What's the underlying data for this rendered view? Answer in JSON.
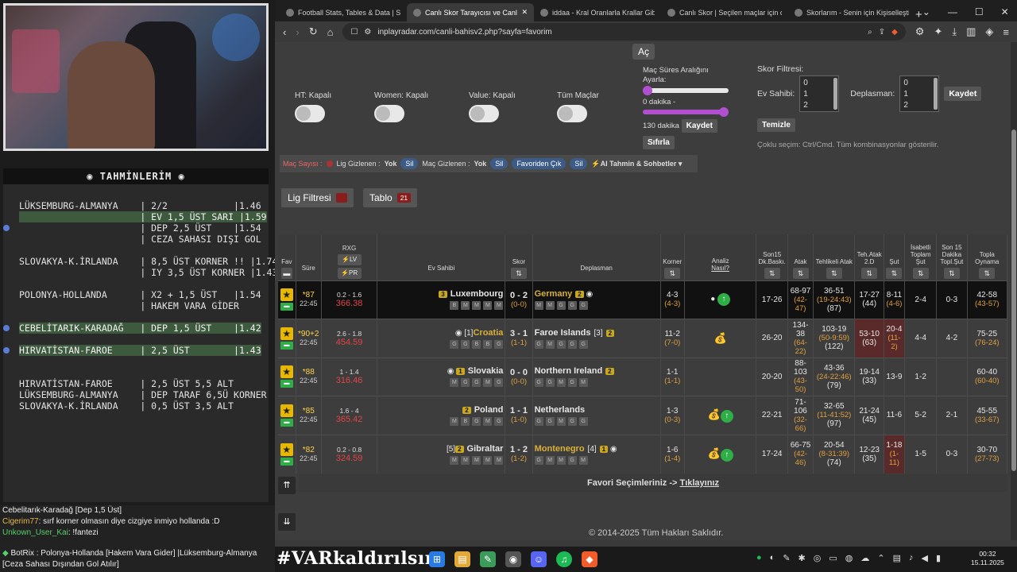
{
  "stream": {
    "predictions_title": "TAHMİNLERİM",
    "predictions": [
      {
        "text": "LÜKSEMBURG-ALMANYA    | 2/2            |1.46",
        "hl": false,
        "dot": false
      },
      {
        "text": "                      | EV 1,5 ÜST SARI |1.59",
        "hl": true,
        "dot": false
      },
      {
        "text": "                      | DEP 2,5 ÜST    |1.54",
        "hl": false,
        "dot": true
      },
      {
        "text": "                      | CEZA SAHASI DIŞI GOL",
        "hl": false,
        "dot": false
      },
      {
        "text": "",
        "hl": false,
        "dot": false
      },
      {
        "text": "SLOVAKYA-K.İRLANDA    | 8,5 ÜST KORNER !! |1.74",
        "hl": false,
        "dot": false
      },
      {
        "text": "                      | IY 3,5 ÜST KORNER |1.43",
        "hl": false,
        "dot": false
      },
      {
        "text": "",
        "hl": false,
        "dot": false
      },
      {
        "text": "POLONYA-HOLLANDA      | X2 + 1,5 ÜST   |1.54",
        "hl": false,
        "dot": false
      },
      {
        "text": "                      | HAKEM VARA GİDER",
        "hl": false,
        "dot": false
      },
      {
        "text": "",
        "hl": false,
        "dot": false
      },
      {
        "text": "CEBELİTARIK-KARADAĞ   | DEP 1,5 ÜST    |1.42",
        "hl": true,
        "dot": true
      },
      {
        "text": "",
        "hl": false,
        "dot": false
      },
      {
        "text": "HIRVATİSTAN-FAROE     | 2,5 ÜST        |1.43",
        "hl": true,
        "dot": true
      },
      {
        "text": "",
        "hl": false,
        "dot": false
      },
      {
        "text": "",
        "hl": false,
        "dot": false
      },
      {
        "text": "HIRVATİSTAN-FAROE     | 2,5 ÜST 5,5 ALT",
        "hl": false,
        "dot": false
      },
      {
        "text": "LÜKSEMBURG-ALMANYA    | DEP TARAF 6,5Ü KORNER",
        "hl": false,
        "dot": false
      },
      {
        "text": "SLOVAKYA-K.İRLANDA    | 0,5 ÜST 3,5 ALT",
        "hl": false,
        "dot": false
      }
    ],
    "chat": [
      {
        "user": "",
        "msg": "Cebelitarık-Karadağ [Dep 1,5 Üst]",
        "cls": ""
      },
      {
        "user": "Cigerim77",
        "msg": ": sırf korner olmasın diye cizgiye inmiyo hollanda :D",
        "cls": "u1"
      },
      {
        "user": "Unkown_User_Kai",
        "msg": ": !fantezi",
        "cls": "u3"
      }
    ],
    "bot_line1": "BotRix : Polonya-Hollanda [Hakem Vara Gider] |Lüksemburg-Almanya",
    "bot_line2": "[Ceza Sahası Dışından Gol Atılır]",
    "hashtag": "#VARkaldırılsın"
  },
  "browser": {
    "tabs": [
      {
        "label": "Football Stats, Tables & Data | Socc",
        "active": false
      },
      {
        "label": "Canlı Skor Tarayıcısı ve Canlı Sk",
        "active": true
      },
      {
        "label": "iddaa - Kral Oranlarla Krallar Gibi K",
        "active": false
      },
      {
        "label": "Canlı Skor | Seçilen maçlar için canl",
        "active": false
      },
      {
        "label": "Skorlarım - Senin için Kişiselleştirilm",
        "active": false
      }
    ],
    "url": "inplayradar.com/canli-bahisv2.php?sayfa=favorim"
  },
  "page": {
    "ac_label": "Aç",
    "toggles": [
      "HT: Kapalı",
      "Women: Kapalı",
      "Value: Kapalı",
      "Tüm Maçlar"
    ],
    "duration_label": "Maç Süres Aralığını Ayarla:",
    "duration_min": "0 dakika -",
    "duration_max": "130 dakika",
    "save_label": "Kaydet",
    "reset_label": "Sıfırla",
    "score_filter_label": "Skor Filtresi:",
    "home_label": "Ev Sahibi:",
    "away_label": "Deplasman:",
    "score_options": [
      "0",
      "1",
      "2"
    ],
    "clear_label": "Temizle",
    "hint": "Çoklu seçim: Ctrl/Cmd. Tüm kombinasyonlar gösterilir.",
    "match_count_label": "Maç Sayısı :",
    "league_hidden_label": "Lig Gizlenen :",
    "none_label": "Yok",
    "delete_label": "Sil",
    "match_hidden_label": "Maç Gizlenen :",
    "remove_fav_label": "Favoriden Çık",
    "ai_label": "AI Tahmin & Sohbetler",
    "league_filter_label": "Lig Filtresi",
    "table_label": "Tablo",
    "table_count": "21",
    "fav_selection_text": "Favori Seçimleriniz ->",
    "fav_link": "Tıklayınız",
    "copyright": "© 2014-2025 Tüm Hakları Saklıdır."
  },
  "table": {
    "headers": {
      "fav": "Fav",
      "sure": "Süre",
      "rxg": "RXG",
      "lv": "LV",
      "pr": "PR",
      "home": "Ev Sahibi",
      "score": "Skor",
      "away": "Deplasman",
      "corner": "Korner",
      "analysis": "Analiz",
      "how": "Nasıl?",
      "son15": "Son15 Dk.Baskı.",
      "attack": "Atak",
      "dangerous": "Tehlikeli Atak",
      "threat": "Teh.Atak 2.D",
      "shot": "Şut",
      "accurate": "İsabetli Toplam Şut",
      "last15": "Son 15 Dakika Topl.Şut",
      "possession": "Topla Oynama"
    },
    "rows": [
      {
        "min": "*87",
        "time": "22:45",
        "rxg_a": "0.2 - 1.6",
        "rxg_b": "366.38",
        "home": "Luxembourg",
        "home_card": "3",
        "home_rank": "",
        "home_io": false,
        "home_hi": false,
        "home_form": [
          "B",
          "M",
          "M",
          "M",
          "M"
        ],
        "score": "0 - 2",
        "ht": "(0-0)",
        "away": "Germany",
        "away_card": "2",
        "away_rank": "",
        "away_io": true,
        "away_hi": true,
        "away_form": [
          "M",
          "M",
          "G",
          "G",
          "G"
        ],
        "corner": "4-3",
        "corner_ht": "(4-3)",
        "analysis": "up",
        "son15": "17-26",
        "attack": "68-97",
        "attack_sub": "(42-47)",
        "dangerous": "36-51",
        "dangerous_sub": "(19-24:43)",
        "dangerous_total": "(87)",
        "threat": "17-27",
        "threat_sub": "(44)",
        "shot": "8-11",
        "shot_sub": "(4-6)",
        "accurate": "2-4",
        "last15": "0-3",
        "poss": "42-58",
        "poss_sub": "(43-57)",
        "red_shot": false,
        "red_threat": false
      },
      {
        "min": "*90+2",
        "time": "22:45",
        "rxg_a": "2.6 - 1.8",
        "rxg_b": "454.59",
        "home": "Croatia",
        "home_card": "",
        "home_rank": "[1]",
        "home_io": true,
        "home_hi": true,
        "home_form": [
          "G",
          "G",
          "B",
          "B",
          "G"
        ],
        "score": "3 - 1",
        "ht": "(1-1)",
        "away": "Faroe Islands",
        "away_card": "2",
        "away_rank": "[3]",
        "away_io": false,
        "away_hi": false,
        "away_form": [
          "G",
          "M",
          "G",
          "G",
          "G"
        ],
        "corner": "11-2",
        "corner_ht": "(7-0)",
        "analysis": "bag",
        "son15": "26-20",
        "attack": "134-38",
        "attack_sub": "(64-22)",
        "dangerous": "103-19",
        "dangerous_sub": "(50-9:59)",
        "dangerous_total": "(122)",
        "threat": "53-10",
        "threat_sub": "(63)",
        "shot": "20-4",
        "shot_sub": "(11-2)",
        "accurate": "4-4",
        "last15": "4-2",
        "poss": "75-25",
        "poss_sub": "(76-24)",
        "red_shot": true,
        "red_threat": true
      },
      {
        "min": "*88",
        "time": "22:45",
        "rxg_a": "1 - 1.4",
        "rxg_b": "316.46",
        "home": "Slovakia",
        "home_card": "1",
        "home_rank": "",
        "home_io": true,
        "home_hi": false,
        "home_form": [
          "M",
          "G",
          "G",
          "M",
          "G"
        ],
        "score": "0 - 0",
        "ht": "(0-0)",
        "away": "Northern Ireland",
        "away_card": "2",
        "away_rank": "",
        "away_io": false,
        "away_hi": false,
        "away_form": [
          "G",
          "G",
          "M",
          "G",
          "M"
        ],
        "corner": "1-1",
        "corner_ht": "(1-1)",
        "analysis": "",
        "son15": "20-20",
        "attack": "88-103",
        "attack_sub": "(43-50)",
        "dangerous": "43-36",
        "dangerous_sub": "(24-22:46)",
        "dangerous_total": "(79)",
        "threat": "19-14",
        "threat_sub": "(33)",
        "shot": "13-9",
        "shot_sub": "",
        "accurate": "1-2",
        "last15": "",
        "poss": "60-40",
        "poss_sub": "(60-40)",
        "red_shot": false,
        "red_threat": false
      },
      {
        "min": "*85",
        "time": "22:45",
        "rxg_a": "1.6 - 4",
        "rxg_b": "365.42",
        "home": "Poland",
        "home_card": "2",
        "home_rank": "",
        "home_io": false,
        "home_hi": false,
        "home_form": [
          "M",
          "B",
          "G",
          "M",
          "G"
        ],
        "score": "1 - 1",
        "ht": "(1-0)",
        "away": "Netherlands",
        "away_card": "",
        "away_rank": "",
        "away_io": false,
        "away_hi": false,
        "away_form": [
          "G",
          "G",
          "M",
          "G",
          "G"
        ],
        "corner": "1-3",
        "corner_ht": "(0-3)",
        "analysis": "bagup",
        "son15": "22-21",
        "attack": "71-106",
        "attack_sub": "(32-66)",
        "dangerous": "32-65",
        "dangerous_sub": "(11-41:52)",
        "dangerous_total": "(97)",
        "threat": "21-24",
        "threat_sub": "(45)",
        "shot": "11-6",
        "shot_sub": "",
        "accurate": "5-2",
        "last15": "2-1",
        "poss": "45-55",
        "poss_sub": "(33-67)",
        "red_shot": false,
        "red_threat": false
      },
      {
        "min": "*82",
        "time": "22:45",
        "rxg_a": "0.2 - 0.8",
        "rxg_b": "324.59",
        "home": "Gibraltar",
        "home_card": "2",
        "home_rank": "[5]",
        "home_io": false,
        "home_hi": false,
        "home_form": [
          "M",
          "M",
          "M",
          "M",
          "M"
        ],
        "score": "1 - 2",
        "ht": "(1-2)",
        "away": "Montenegro",
        "away_card": "1",
        "away_rank": "[4]",
        "away_io": true,
        "away_hi": true,
        "away_form": [
          "G",
          "M",
          "M",
          "G",
          "M"
        ],
        "corner": "1-6",
        "corner_ht": "(1-4)",
        "analysis": "bagup",
        "son15": "17-24",
        "attack": "66-75",
        "attack_sub": "(42-46)",
        "dangerous": "20-54",
        "dangerous_sub": "(8-31:39)",
        "dangerous_total": "(74)",
        "threat": "12-23",
        "threat_sub": "(35)",
        "shot": "1-18",
        "shot_sub": "(1-11)",
        "accurate": "1-5",
        "last15": "0-3",
        "poss": "30-70",
        "poss_sub": "(27-73)",
        "red_shot": true,
        "red_threat": false
      }
    ]
  },
  "taskbar": {
    "time": "00:32",
    "date": "15.11.2025"
  }
}
